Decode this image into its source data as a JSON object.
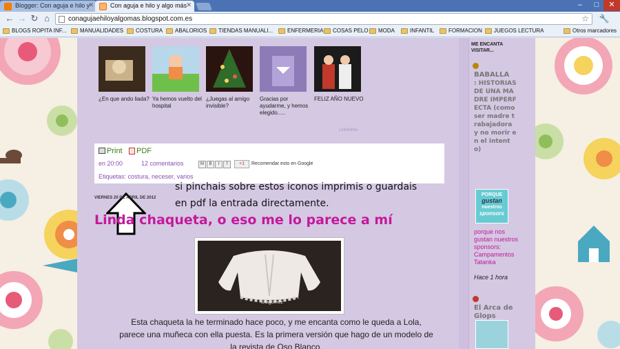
{
  "browser": {
    "tabs": [
      {
        "label": "Blogger: Con aguja e hilo y"
      },
      {
        "label": "Con aguja e hilo y algo más"
      }
    ],
    "url": "conagujaehiloyalgomas.blogspot.com.es",
    "bookmarks": [
      "BLOGS ROPITA INF...",
      "MANUALIDADES",
      "COSTURA",
      "ABALORIOS",
      "TIENDAS MANUALI...",
      "ENFERMERIA",
      "COSAS PELO",
      "MODA",
      "INFANTIL",
      "FORMACION",
      "JUEGOS LECTURA"
    ],
    "other_bookmarks": "Otros marcadores"
  },
  "related": {
    "items": [
      {
        "caption": "¿En que ando liada?"
      },
      {
        "caption": "Ya hemos vuelto del hospital"
      },
      {
        "caption": "¿Juegas al amigo invisible?"
      },
      {
        "caption": "Gracias por ayudarme, y hemos elegido....."
      },
      {
        "caption": "FELIZ AÑO NUEVO"
      }
    ],
    "linkwithin": "LinkWithin"
  },
  "postbox": {
    "print": "Print",
    "pdf": "PDF",
    "date_link": "en 20:00",
    "comments": "12 comentarios",
    "recommend": "Recomendar esto en Google",
    "gplus": "+1",
    "tags": "Etiquetas: costura, neceser, varios"
  },
  "hint": {
    "line1": "si pinchais sobre estos iconos imprimis o guardais",
    "line2": "en pdf la entrada directamente."
  },
  "post": {
    "date": "VIERNES 20 DE ABRIL DE 2012",
    "title": "Linda chaqueta, o eso me lo parece a mí",
    "photo_tag": "lolagomez",
    "body1": "Esta chaqueta la he terminado hace poco, y me encanta como le queda a Lola,",
    "body2": "parece una muñeca con ella puesta. Es la primera versión que hago de un modelo de",
    "body3": "la revista de Oso Blanco."
  },
  "sidebar": {
    "title": "ME ENCANTA VISITAR...",
    "blog1_name": "BABALLA",
    "blog1_rest": ": HISTORIAS DE UNA MADRE IMPERFECTA (como ser madre trabajadora y no morir en el intento)",
    "badge_l1": "PORQUE",
    "badge_l2": "gustan",
    "badge_l3": "nuestros",
    "badge_l4": "sponsors",
    "why": "porque nos gustan nuestros sponsors: Campamentos Tatanka",
    "when": "Hace 1 hora",
    "blog2": "El Arca de Glops"
  },
  "colors": {
    "accent_pink": "#c4199b",
    "link_purple": "#8a4fb5",
    "print_green": "#3a7a1a",
    "content_bg": "#d4c8e2"
  }
}
